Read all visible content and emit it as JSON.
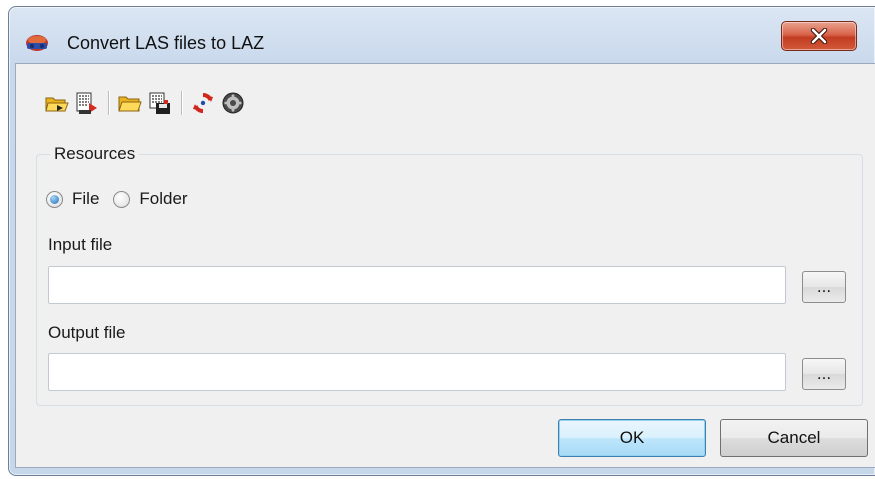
{
  "window": {
    "title": "Convert LAS files to LAZ",
    "close_label": "x"
  },
  "toolbar": {
    "buttons": [
      {
        "icon": "open-settings-icon",
        "tooltip": ""
      },
      {
        "icon": "save-settings-icon",
        "tooltip": ""
      },
      {
        "icon": "open-folder-icon",
        "tooltip": ""
      },
      {
        "icon": "save-file-icon",
        "tooltip": ""
      },
      {
        "icon": "refresh-icon",
        "tooltip": ""
      },
      {
        "icon": "film-reel-icon",
        "tooltip": ""
      }
    ]
  },
  "resources": {
    "title": "Resources",
    "mode_options": [
      {
        "label": "File",
        "selected": true
      },
      {
        "label": "Folder",
        "selected": false
      }
    ],
    "input_label": "Input file",
    "input_value": "",
    "output_label": "Output file",
    "output_value": "",
    "browse_label": "..."
  },
  "buttons": {
    "ok": "OK",
    "cancel": "Cancel"
  },
  "colors": {
    "title_bar": "#c9d9ec",
    "close_button": "#c23c21",
    "dialog_bg": "#f0f0f0",
    "default_button": "#bee6fd"
  }
}
